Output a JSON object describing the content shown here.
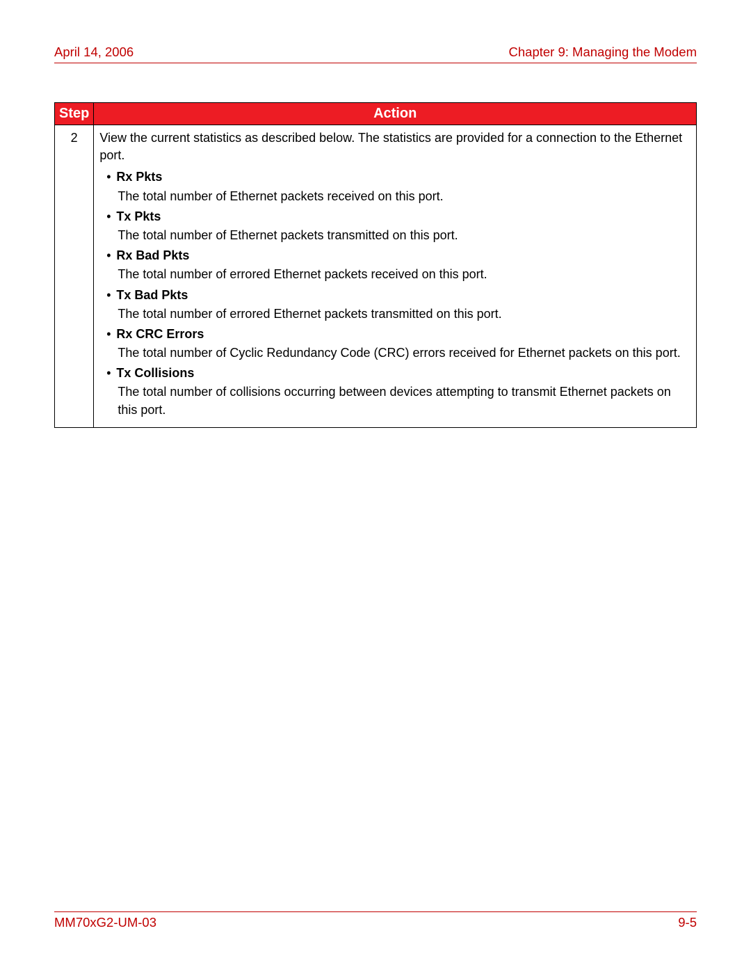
{
  "header": {
    "date": "April 14, 2006",
    "chapter": "Chapter 9: Managing the Modem"
  },
  "table": {
    "columns": {
      "step": "Step",
      "action": "Action"
    },
    "row": {
      "step": "2",
      "intro": "View the current statistics as described below. The statistics are provided for a connection to the Ethernet port.",
      "stats": [
        {
          "label": "Rx Pkts",
          "desc": "The total number of Ethernet packets received on this port."
        },
        {
          "label": "Tx Pkts",
          "desc": "The total number of Ethernet packets transmitted on this port."
        },
        {
          "label": "Rx Bad Pkts",
          "desc": "The total number of errored Ethernet packets received on this port."
        },
        {
          "label": "Tx Bad Pkts",
          "desc": "The total number of errored Ethernet packets transmitted on this port."
        },
        {
          "label": "Rx CRC Errors",
          "desc": "The total number of Cyclic Redundancy Code (CRC) errors received for Ethernet packets on this port."
        },
        {
          "label": "Tx Collisions",
          "desc": "The total number of collisions occurring between devices attempting to transmit Ethernet packets on this port."
        }
      ]
    }
  },
  "footer": {
    "doc_id": "MM70xG2-UM-03",
    "page_num": "9-5"
  }
}
